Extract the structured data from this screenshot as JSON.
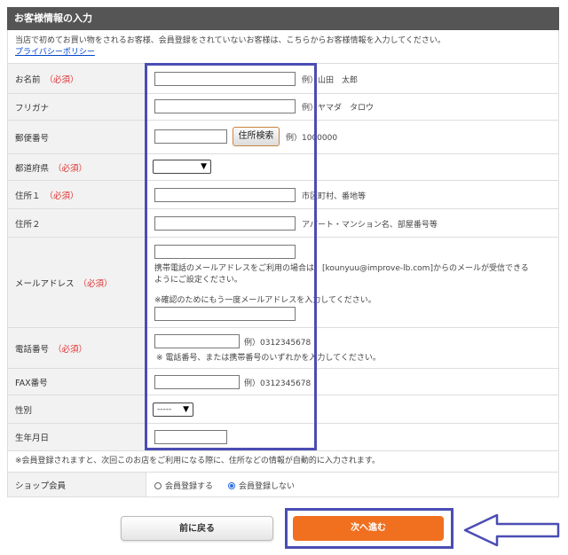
{
  "header": {
    "title": "お客様情報の入力"
  },
  "intro": {
    "text": "当店で初めてお買い物をされるお客様、会員登録をされていないお客様は、こちらからお客様情報を入力してください。",
    "privacy_link": "プライバシーポリシー"
  },
  "required_mark": "（必須）",
  "fields": {
    "name": {
      "label": "お名前",
      "value": "",
      "example": "例）山田　太郎"
    },
    "furigana": {
      "label": "フリガナ",
      "value": "",
      "example": "例）ヤマダ　タロウ"
    },
    "postal": {
      "label": "郵便番号",
      "value": "",
      "button": "住所検索",
      "example": "例）1000000"
    },
    "prefecture": {
      "label": "都道府県",
      "selected": ""
    },
    "address1": {
      "label": "住所１",
      "value": "",
      "example": "市区町村、番地等"
    },
    "address2": {
      "label": "住所２",
      "value": "",
      "example": "アパート・マンション名、部屋番号等"
    },
    "email": {
      "label": "メールアドレス",
      "value": "",
      "note_line1": "携帯電話のメールアドレスをご利用の場合は、[kounyuu@improve-lb.com]からのメールが受信できる",
      "note_line2": "ようにご設定ください。",
      "confirm_note": "※確認のためにもう一度メールアドレスを入力してください。",
      "confirm_value": ""
    },
    "phone": {
      "label": "電話番号",
      "value": "",
      "example": "例）0312345678",
      "note": "※ 電話番号、または携帯番号のいずれかを入力してください。"
    },
    "fax": {
      "label": "FAX番号",
      "value": "",
      "example": "例）0312345678"
    },
    "gender": {
      "label": "性別",
      "selected": "-----"
    },
    "birthday": {
      "label": "生年月日",
      "value": ""
    }
  },
  "membership_note": "※会員登録されますと、次回このお店をご利用になる際に、住所などの情報が自動的に入力されます。",
  "shop_member": {
    "label": "ショップ会員",
    "option_register": "会員登録する",
    "option_no_register": "会員登録しない",
    "selected": "会員登録しない"
  },
  "buttons": {
    "back": "前に戻る",
    "next": "次へ進む"
  },
  "colors": {
    "header_bg": "#555555",
    "required": "#e03030",
    "next_button": "#f07020",
    "highlight": "#4b4db3"
  }
}
